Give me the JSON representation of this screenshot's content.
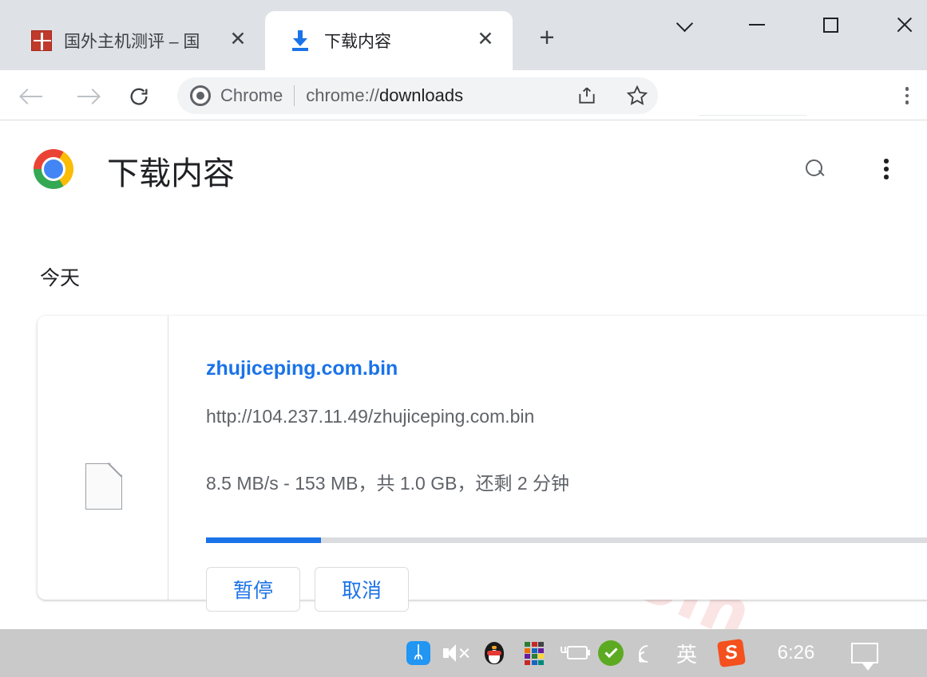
{
  "window": {
    "controls": [
      {
        "name": "chevron-down",
        "label": "⌄"
      },
      {
        "name": "minimize",
        "label": "—"
      },
      {
        "name": "maximize",
        "label": "□"
      },
      {
        "name": "close",
        "label": "✕"
      }
    ]
  },
  "tabs": [
    {
      "title": "国外主机测评 – 国",
      "icon": "seal-favicon",
      "active": false,
      "close_label": "✕"
    },
    {
      "title": "下载内容",
      "icon": "download-icon",
      "active": true,
      "close_label": "✕"
    }
  ],
  "newtab_label": "+",
  "toolbar": {
    "back_icon": "back-arrow-icon",
    "forward_icon": "forward-arrow-icon",
    "reload_icon": "reload-icon",
    "omnibox": {
      "scheme_label": "Chrome",
      "url_prefix": "chrome://",
      "url_main": "downloads",
      "full_url": "chrome://downloads"
    },
    "share_icon": "share-icon",
    "bookmark_icon": "star-icon",
    "menu_icon": "kebab-menu-icon"
  },
  "page": {
    "title": "下载内容",
    "logo": "chrome-logo",
    "search_icon": "search-icon",
    "menu_icon": "kebab-menu-icon",
    "watermark": "zhujiceping.com",
    "section_label": "今天",
    "download": {
      "file_icon": "generic-file-icon",
      "filename": "zhujiceping.com.bin",
      "url": "http://104.237.11.49/zhujiceping.com.bin",
      "status": "8.5 MB/s - 153 MB，共 1.0 GB，还剩 2 分钟",
      "speed": "8.5 MB/s",
      "downloaded": "153 MB",
      "total_size": "1.0 GB",
      "time_remaining": "2 分钟",
      "progress_percent": 15,
      "buttons": [
        {
          "label": "暂停",
          "name": "pause-button"
        },
        {
          "label": "取消",
          "name": "cancel-button"
        }
      ]
    }
  },
  "taskbar": {
    "icons": [
      {
        "name": "bluetooth-icon",
        "glyph": "ᛦ"
      },
      {
        "name": "speaker-muted-icon"
      },
      {
        "name": "qq-penguin-icon"
      },
      {
        "name": "color-grid-icon"
      },
      {
        "name": "battery-charging-icon"
      },
      {
        "name": "security-check-icon"
      },
      {
        "name": "wifi-icon"
      },
      {
        "name": "ime-indicator",
        "glyph": "英"
      },
      {
        "name": "sogou-input-icon",
        "glyph": "S"
      }
    ],
    "clock": "6:26",
    "notification_icon": "notification-bubble-icon"
  },
  "colors": {
    "accent_blue": "#1a73e8",
    "tabstrip_bg": "#dee1e6",
    "taskbar_bg": "#c9c9c9",
    "watermark_pink": "#fbe4e4",
    "text_primary": "#202124",
    "text_secondary": "#5f6368"
  }
}
